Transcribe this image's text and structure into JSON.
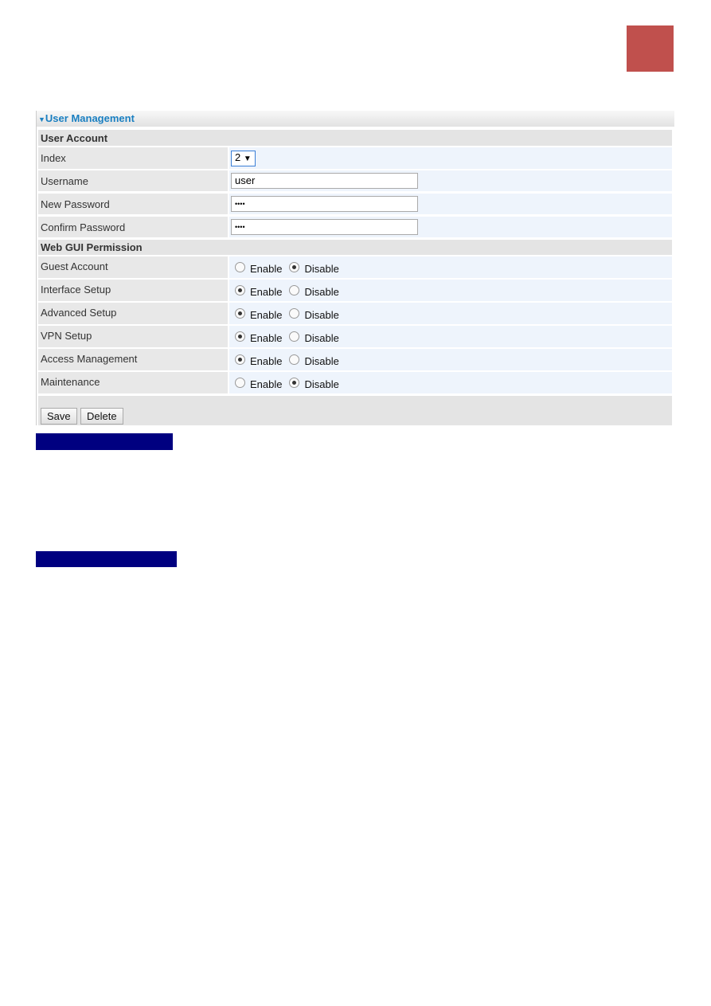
{
  "panel": {
    "title": "User Management"
  },
  "user_account": {
    "heading": "User Account",
    "index_label": "Index",
    "index_value": "2",
    "username_label": "Username",
    "username_value": "user",
    "new_password_label": "New Password",
    "new_password_value": "••••",
    "confirm_password_label": "Confirm Password",
    "confirm_password_value": "••••"
  },
  "permissions": {
    "heading": "Web GUI Permission",
    "enable_label": "Enable",
    "disable_label": "Disable",
    "items": [
      {
        "label": "Guest Account",
        "value": "Disable"
      },
      {
        "label": "Interface Setup",
        "value": "Enable"
      },
      {
        "label": "Advanced Setup",
        "value": "Enable"
      },
      {
        "label": "VPN Setup",
        "value": "Enable"
      },
      {
        "label": "Access Management",
        "value": "Enable"
      },
      {
        "label": "Maintenance",
        "value": "Disable"
      }
    ]
  },
  "buttons": {
    "save": "Save",
    "delete": "Delete"
  },
  "colors": {
    "corner_box": "#c0504d",
    "section_bar": "#000080",
    "panel_title": "#1a7fc1"
  }
}
